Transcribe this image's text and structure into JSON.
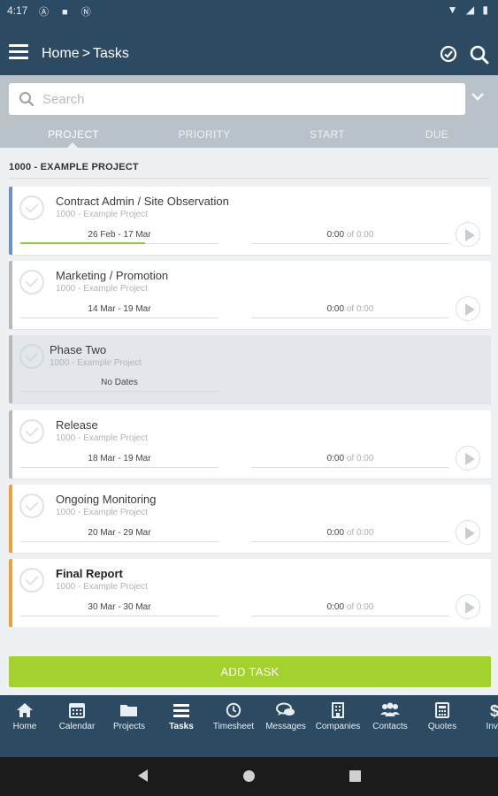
{
  "status_bar": {
    "time": "4:17",
    "left_icons": "Ⓐ ■ Ⓝ",
    "right_icons": "▼ ◢ ▮"
  },
  "app_bar": {
    "crumb_home": "Home",
    "crumb_sep": ">",
    "crumb_current": "Tasks"
  },
  "search": {
    "placeholder": "Search",
    "value": ""
  },
  "sort_tabs": [
    "PROJECT",
    "PRIORITY",
    "START",
    "DUE"
  ],
  "group": {
    "title": "1000 - EXAMPLE PROJECT"
  },
  "tasks": [
    {
      "name": "Contract Admin / Site Observation",
      "project": "1000 - Example Project",
      "dates": "26 Feb - 17 Mar",
      "time_spent": "0:00",
      "time_of": "of",
      "time_total": "0:00",
      "border_color": "#6f8fc9",
      "progress_pct": 63,
      "bold": false
    },
    {
      "name": "Marketing / Promotion",
      "project": "1000 - Example Project",
      "dates": "14 Mar - 19 Mar",
      "time_spent": "0:00",
      "time_of": "of",
      "time_total": "0:00",
      "border_color": "#b8b8b8",
      "bold": false
    },
    {
      "name": "Phase Two",
      "project": "1000 - Example Project",
      "dates": "No Dates",
      "border_color": "#b8b8b8",
      "bold": false
    },
    {
      "name": "Release",
      "project": "1000 - Example Project",
      "dates": "18 Mar - 19 Mar",
      "time_spent": "0:00",
      "time_of": "of",
      "time_total": "0:00",
      "border_color": "#b8b8b8",
      "bold": false
    },
    {
      "name": "Ongoing Monitoring",
      "project": "1000 - Example Project",
      "dates": "20 Mar - 29 Mar",
      "time_spent": "0:00",
      "time_of": "of",
      "time_total": "0:00",
      "border_color": "#e8a33d",
      "bold": false
    },
    {
      "name": "Final Report",
      "project": "1000 - Example Project",
      "dates": "30 Mar - 30 Mar",
      "time_spent": "0:00",
      "time_of": "of",
      "time_total": "0:00",
      "border_color": "#e8a33d",
      "bold": true
    }
  ],
  "add_task": {
    "label": "ADD TASK"
  },
  "bottom_nav": [
    {
      "label": "Home",
      "icon": "home-icon"
    },
    {
      "label": "Calendar",
      "icon": "calendar-icon"
    },
    {
      "label": "Projects",
      "icon": "folder-icon"
    },
    {
      "label": "Tasks",
      "icon": "tasks-icon",
      "active": true
    },
    {
      "label": "Timesheet",
      "icon": "clock-icon"
    },
    {
      "label": "Messages",
      "icon": "messages-icon"
    },
    {
      "label": "Companies",
      "icon": "building-icon"
    },
    {
      "label": "Contacts",
      "icon": "contacts-icon"
    },
    {
      "label": "Quotes",
      "icon": "calculator-icon"
    },
    {
      "label": "Invo",
      "icon": "dollar-icon"
    }
  ],
  "colors": {
    "primary": "#2d4a63",
    "accent": "#a3d12f",
    "filter_bg": "#b9c2c9",
    "content_bg": "#eef1f3"
  }
}
